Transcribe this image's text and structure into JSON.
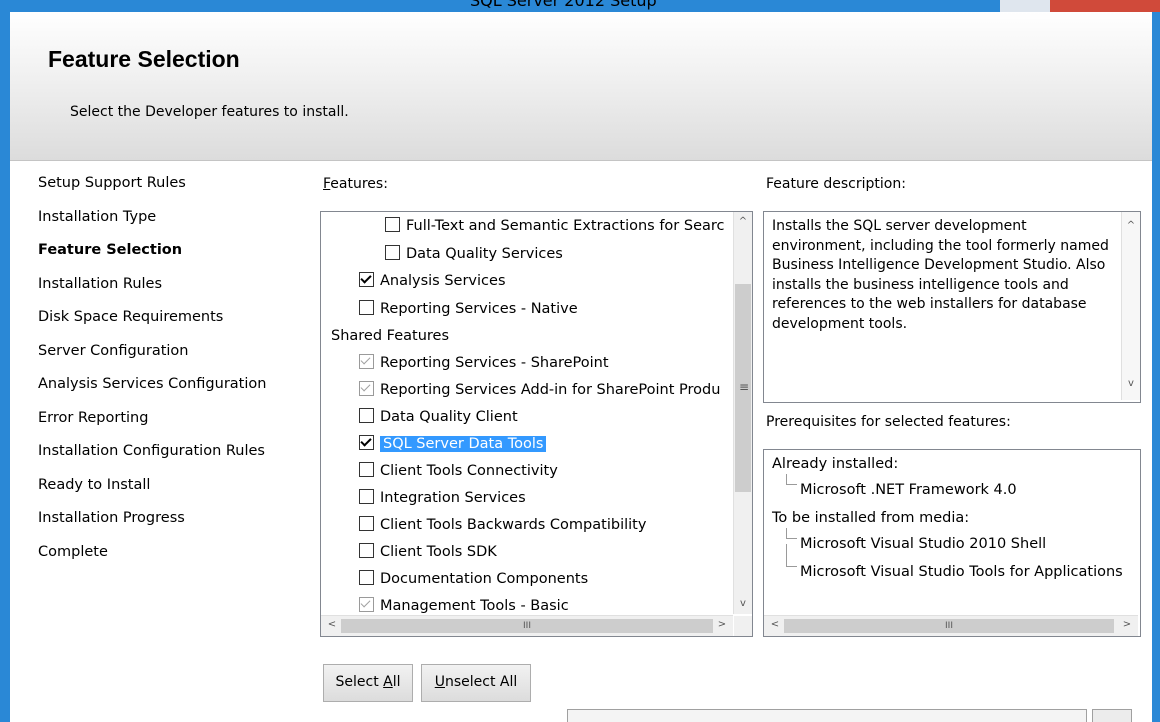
{
  "window": {
    "title": "SQL Server 2012 Setup"
  },
  "header": {
    "title": "Feature Selection",
    "subtitle": "Select the Developer features to install."
  },
  "nav": {
    "items": [
      {
        "label": "Setup Support Rules",
        "active": false
      },
      {
        "label": "Installation Type",
        "active": false
      },
      {
        "label": "Feature Selection",
        "active": true
      },
      {
        "label": "Installation Rules",
        "active": false
      },
      {
        "label": "Disk Space Requirements",
        "active": false
      },
      {
        "label": "Server Configuration",
        "active": false
      },
      {
        "label": "Analysis Services Configuration",
        "active": false
      },
      {
        "label": "Error Reporting",
        "active": false
      },
      {
        "label": "Installation Configuration Rules",
        "active": false
      },
      {
        "label": "Ready to Install",
        "active": false
      },
      {
        "label": "Installation Progress",
        "active": false
      },
      {
        "label": "Complete",
        "active": false
      }
    ]
  },
  "features": {
    "label_accel": "F",
    "label_rest": "eatures:",
    "items": [
      {
        "label": "Full-Text and Semantic Extractions for Searc",
        "state": "unchecked"
      },
      {
        "label": "Data Quality Services",
        "state": "unchecked"
      },
      {
        "label": "Analysis Services",
        "state": "checked"
      },
      {
        "label": "Reporting Services - Native",
        "state": "unchecked"
      },
      {
        "label": "Shared Features",
        "state": "group"
      },
      {
        "label": "Reporting Services - SharePoint",
        "state": "dimmed"
      },
      {
        "label": "Reporting Services Add-in for SharePoint Produ",
        "state": "dimmed"
      },
      {
        "label": "Data Quality Client",
        "state": "unchecked"
      },
      {
        "label": "SQL Server Data Tools",
        "state": "checked",
        "selected": true
      },
      {
        "label": "Client Tools Connectivity",
        "state": "unchecked"
      },
      {
        "label": "Integration Services",
        "state": "unchecked"
      },
      {
        "label": "Client Tools Backwards Compatibility",
        "state": "unchecked"
      },
      {
        "label": "Client Tools SDK",
        "state": "unchecked"
      },
      {
        "label": "Documentation Components",
        "state": "unchecked"
      },
      {
        "label": "Management Tools - Basic",
        "state": "dimmed"
      }
    ]
  },
  "description": {
    "label": "Feature description:",
    "text": "Installs the SQL server development environment, including the tool formerly named Business Intelligence Development Studio. Also installs the business intelligence tools and references to the web installers for database development tools."
  },
  "prerequisites": {
    "label": "Prerequisites for selected features:",
    "already_installed_label": "Already installed:",
    "already_installed": [
      "Microsoft .NET Framework 4.0"
    ],
    "to_install_label": "To be installed from media:",
    "to_install": [
      "Microsoft Visual Studio 2010 Shell",
      "Microsoft Visual Studio Tools for Applications"
    ]
  },
  "buttons": {
    "select_all_pre": "Select ",
    "select_all_accel": "A",
    "select_all_post": "ll",
    "unselect_all_accel": "U",
    "unselect_all_post": "nselect All"
  },
  "scroll_glyphs": {
    "up": "^",
    "down": "v",
    "left": "<",
    "right": ">",
    "grip_v": "≡",
    "grip_h": "III"
  },
  "colors": {
    "window_frame": "#2a88d6",
    "selection": "#3399ff",
    "header_bg": "#dcdcdc"
  }
}
